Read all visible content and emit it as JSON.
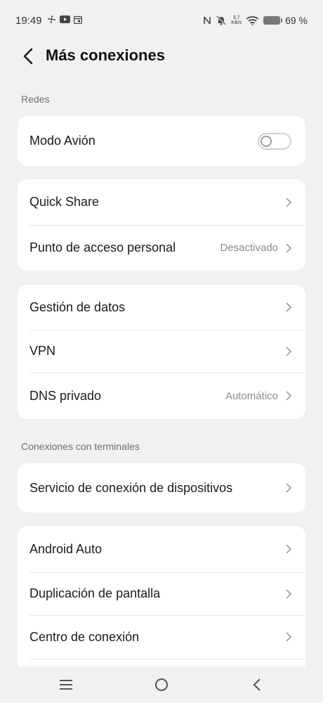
{
  "status_bar": {
    "time": "19:49",
    "net_speed_value": "3,7",
    "net_speed_unit": "KB/s",
    "battery": "69 %",
    "icons": [
      "fan-icon",
      "youtube-icon",
      "calendar-icon",
      "nfc-icon",
      "mute-icon",
      "wifi-icon",
      "battery-icon"
    ]
  },
  "header": {
    "title": "Más conexiones",
    "back_icon": "chevron-left-icon"
  },
  "sections": {
    "redes": "Redes",
    "conexiones": "Conexiones con terminales"
  },
  "items": {
    "modo_avion": {
      "label": "Modo Avión",
      "toggle_on": false
    },
    "quick_share": {
      "label": "Quick Share"
    },
    "punto_acceso": {
      "label": "Punto de acceso personal",
      "value": "Desactivado"
    },
    "gestion_datos": {
      "label": "Gestión de datos"
    },
    "vpn": {
      "label": "VPN"
    },
    "dns": {
      "label": "DNS privado",
      "value": "Automático"
    },
    "servicio_conexion": {
      "label": "Servicio de conexión de dispositivos"
    },
    "android_auto": {
      "label": "Android Auto"
    },
    "duplicacion": {
      "label": "Duplicación de pantalla"
    },
    "centro_conexion": {
      "label": "Centro de conexión"
    }
  },
  "nav": {
    "icons": [
      "menu-icon",
      "home-icon",
      "back-icon"
    ]
  },
  "colors": {
    "background": "#f1f1f1",
    "card": "#ffffff",
    "text": "#1b1b1b",
    "secondary_text": "#8a8a8a"
  }
}
